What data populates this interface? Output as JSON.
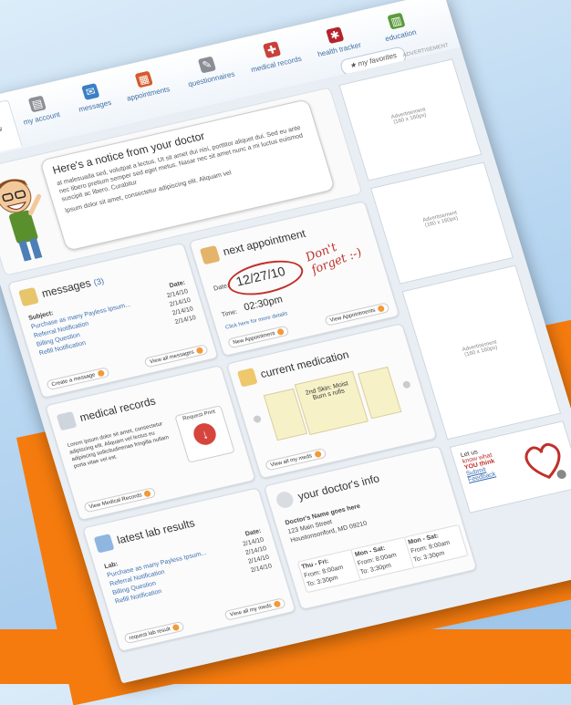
{
  "nav": {
    "tabs": [
      {
        "label": "overview",
        "icon": "home-icon",
        "color": "#c98b2c"
      },
      {
        "label": "my account",
        "icon": "account-icon",
        "color": "#8b8f96"
      },
      {
        "label": "messages",
        "icon": "envelope-icon",
        "color": "#3b7fc4"
      },
      {
        "label": "appointments",
        "icon": "calendar-icon",
        "color": "#d65b2a"
      },
      {
        "label": "questionnaires",
        "icon": "clipboard-icon",
        "color": "#8a8e94"
      },
      {
        "label": "medical records",
        "icon": "medical-case-icon",
        "color": "#c9413a"
      },
      {
        "label": "health tracker",
        "icon": "heart-icon",
        "color": "#b4232c"
      },
      {
        "label": "education",
        "icon": "books-icon",
        "color": "#5a9b3c"
      }
    ],
    "favorites_label": "my favorites",
    "ad_label": "ADVERTISEMENT"
  },
  "notice": {
    "title": "Here's a notice from your doctor",
    "body1": "at malesuada sed, volutpat a lectus. Ut sit amet dui nisi, porttitor aliquet dui. Sed eu ante nec libero pretium semper sed eget metus. Nasar nec sit amet nunc a mi luctus euismod suscipit ac libero. Curabitur",
    "body2": "Ipsum dolor sit amet, consectetur adipiscing elit. Aliquam vel"
  },
  "messages": {
    "title": "messages",
    "count": "(3)",
    "subject_header": "Subject:",
    "date_header": "Date:",
    "rows": [
      {
        "subject": "Purchase as many Payless Ipsum...",
        "date": "2/14/10"
      },
      {
        "subject": "Referral Notification",
        "date": "2/14/10"
      },
      {
        "subject": "Billing Question",
        "date": "2/14/10"
      },
      {
        "subject": "Refill Notification",
        "date": "2/14/10"
      }
    ],
    "create_btn": "Create a message",
    "view_btn": "View all messages"
  },
  "appointment": {
    "title": "next appointment",
    "date_label": "Date:",
    "date": "12/27/10",
    "time_label": "Time:",
    "time": "02:30pm",
    "details_link": "Click here for more details",
    "new_btn": "New Appointment",
    "view_btn": "View Appointments",
    "scribble": "Don't forget :-)"
  },
  "medication": {
    "title": "current medication",
    "pill_text": "2nd Skin: Moist Burn s rufis",
    "view_btn": "View all my meds"
  },
  "records": {
    "title": "medical records",
    "body": "Lorem ipsum dolor sit amet, consectetur adipiscing elit. Aliquam vel lectus eu adipiscing sollicitudinenas fringilla nullam porta vitae vel est.",
    "request_label": "Request Print",
    "view_btn": "View Medical Records"
  },
  "labs": {
    "title": "latest lab results",
    "lab_header": "Lab:",
    "date_header": "Date:",
    "rows": [
      {
        "subject": "Purchase as many Payless Ipsum...",
        "date": "2/14/10"
      },
      {
        "subject": "Referral Notification",
        "date": "2/14/10"
      },
      {
        "subject": "Billing Question",
        "date": "2/14/10"
      },
      {
        "subject": "Refill Notification",
        "date": "2/14/10"
      }
    ],
    "request_btn": "request lab result",
    "view_btn": "View all my meds"
  },
  "doctor": {
    "title": "your doctor's info",
    "name": "Doctor's Name goes here",
    "addr1": "123 Main Street",
    "addr2": "Houstonsonford, MD 09210",
    "hours": [
      {
        "days": "Thu - Fri:",
        "from": "From: 8:00am",
        "to": "To: 3:30pm"
      },
      {
        "days": "Mon - Sat:",
        "from": "From: 8:00am",
        "to": "To: 3:30pm"
      },
      {
        "days": "Mon - Sat:",
        "from": "From: 8:00am",
        "to": "To: 3:30pm"
      }
    ]
  },
  "ads": [
    {
      "line1": "Advertisement",
      "line2": "(160 x 160px)"
    },
    {
      "line1": "Advertisement",
      "line2": "(160 x 160px)"
    },
    {
      "line1": "Advertisement",
      "line2": "(160 x 160px)"
    }
  ],
  "promo": {
    "line1": "Let us",
    "line2": "know what",
    "line3": "YOU think",
    "line4": "Submit",
    "line5": "Feedback"
  }
}
